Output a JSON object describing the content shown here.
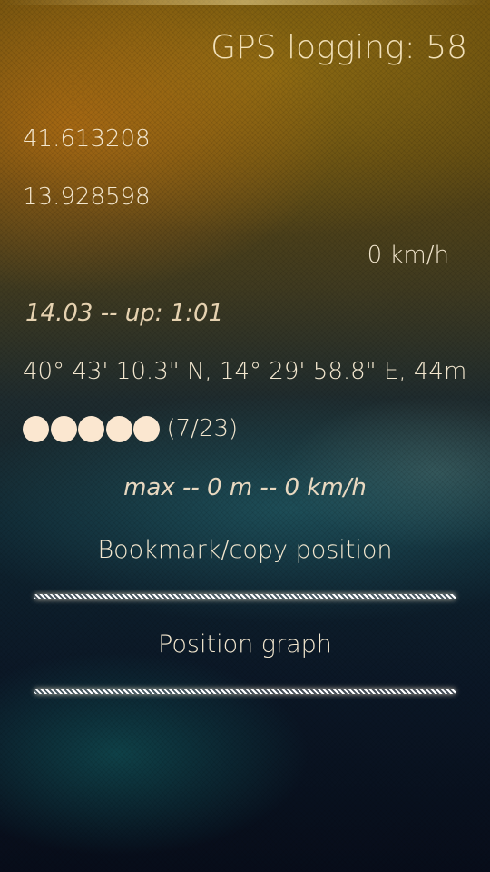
{
  "header": {
    "title": "GPS logging: 58"
  },
  "position": {
    "latitude": "41.613208",
    "longitude": "13.928598",
    "speed": "0 km/h",
    "uptime": "14.03 -- up: 1:01",
    "dms": "40° 43' 10.3\" N, 14° 29' 58.8\" E, 44m"
  },
  "satellites": {
    "indicators": 5,
    "count_text": "(7/23)",
    "dot_color": "#fbe7d0"
  },
  "stats": {
    "max_text": "max -- 0 m -- 0 km/h"
  },
  "buttons": {
    "bookmark_label": "Bookmark/copy position",
    "graph_label": "Position graph"
  }
}
